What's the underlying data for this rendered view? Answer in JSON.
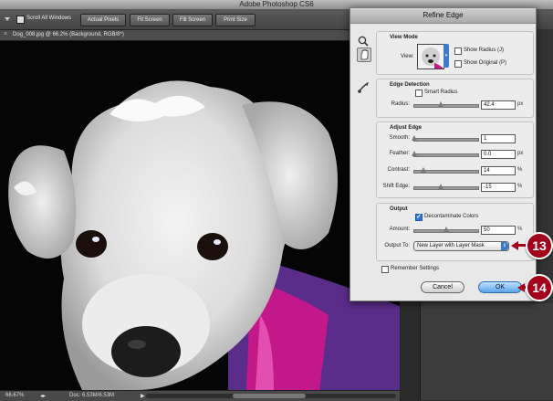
{
  "app": {
    "title": "Adobe Photoshop CS6"
  },
  "options_bar": {
    "scroll_all_windows": "Scroll All Windows",
    "buttons": [
      "Actual Pixels",
      "Fit Screen",
      "Fill Screen",
      "Print Size"
    ]
  },
  "document": {
    "tab": "Dog_008.jpg @ 66.2% (Background, RGB/8*)"
  },
  "status": {
    "zoom": "66.67%",
    "doc": "Doc: 6.53M/6.53M"
  },
  "dialog": {
    "title": "Refine Edge",
    "view_mode": {
      "label": "View Mode",
      "view_label": "View:",
      "show_radius": "Show Radius (J)",
      "show_original": "Show Original (P)"
    },
    "edge_detection": {
      "label": "Edge Detection",
      "smart_radius": "Smart Radius",
      "radius_label": "Radius:",
      "radius_value": "42.4",
      "radius_unit": "px",
      "radius_level": 0.42
    },
    "adjust_edge": {
      "label": "Adjust Edge",
      "smooth_label": "Smooth:",
      "smooth_value": "1",
      "smooth_level": 0.0,
      "feather_label": "Feather:",
      "feather_value": "0.0",
      "feather_unit": "px",
      "feather_level": 0.0,
      "contrast_label": "Contrast:",
      "contrast_value": "14",
      "contrast_unit": "%",
      "contrast_level": 0.14,
      "shift_label": "Shift Edge:",
      "shift_value": "-15",
      "shift_unit": "%",
      "shift_level": 0.42
    },
    "output": {
      "label": "Output",
      "decontaminate": "Decontaminate Colors",
      "amount_label": "Amount:",
      "amount_value": "50",
      "amount_unit": "%",
      "amount_level": 0.5,
      "output_to_label": "Output To:",
      "output_to_value": "New Layer with Layer Mask"
    },
    "remember": "Remember Settings",
    "cancel": "Cancel",
    "ok": "OK"
  },
  "callouts": {
    "step_13": "13",
    "step_14": "14"
  },
  "colors": {
    "callout": "#a3001b",
    "ok_button": "#5aa3ea",
    "accent": "#3b79c9"
  }
}
